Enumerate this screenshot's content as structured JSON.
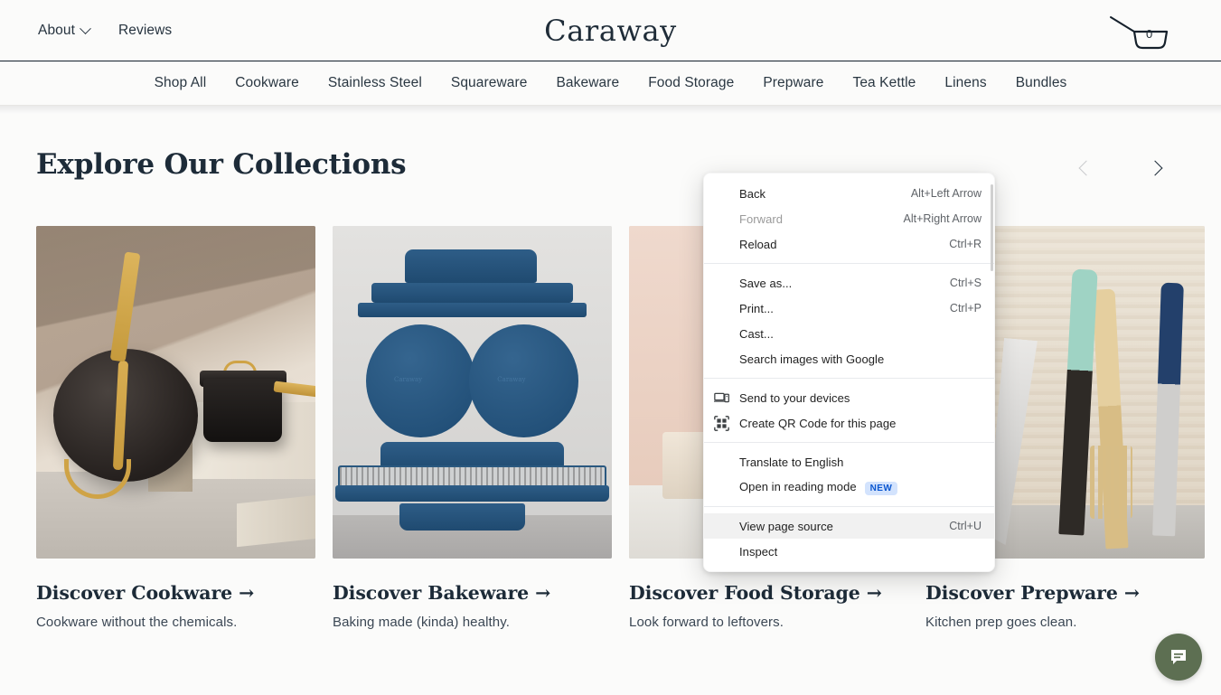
{
  "brand": {
    "name": "Caraway"
  },
  "topnav": {
    "left_items": [
      {
        "label": "About",
        "has_chevron": true
      },
      {
        "label": "Reviews",
        "has_chevron": false
      }
    ],
    "cart": {
      "icon": "shopping-basket-icon",
      "count": "0"
    }
  },
  "subnav": {
    "items": [
      "Shop All",
      "Cookware",
      "Stainless Steel",
      "Squareware",
      "Bakeware",
      "Food Storage",
      "Prepware",
      "Tea Kettle",
      "Linens",
      "Bundles"
    ]
  },
  "collections": {
    "heading": "Explore Our Collections",
    "carousel": {
      "prev_icon": "chevron-left-icon",
      "next_icon": "chevron-right-icon",
      "prev_enabled": false,
      "next_enabled": true
    },
    "cards": [
      {
        "title": "Discover Cookware →",
        "subtitle": "Cookware without the chemicals.",
        "image_alt": "black-frying-pan-and-saucepan-with-gold-handles"
      },
      {
        "title": "Discover Bakeware →",
        "subtitle": "Baking made (kinda) healthy.",
        "image_alt": "stacked-navy-blue-bakeware-set"
      },
      {
        "title": "Discover Food Storage →",
        "subtitle": "Look forward to leftovers.",
        "image_alt": "food-storage-containers-on-pink-backdrop"
      },
      {
        "title": "Discover Prepware →",
        "subtitle": "Kitchen prep goes clean.",
        "image_alt": "knives-and-pasta-server-standing-upright"
      }
    ]
  },
  "context_menu": {
    "groups": [
      {
        "items": [
          {
            "label": "Back",
            "accel": "Alt+Left Arrow",
            "icon": null,
            "disabled": false,
            "hovered": false,
            "badge": null
          },
          {
            "label": "Forward",
            "accel": "Alt+Right Arrow",
            "icon": null,
            "disabled": true,
            "hovered": false,
            "badge": null
          },
          {
            "label": "Reload",
            "accel": "Ctrl+R",
            "icon": null,
            "disabled": false,
            "hovered": false,
            "badge": null
          }
        ]
      },
      {
        "items": [
          {
            "label": "Save as...",
            "accel": "Ctrl+S",
            "icon": null,
            "disabled": false,
            "hovered": false,
            "badge": null
          },
          {
            "label": "Print...",
            "accel": "Ctrl+P",
            "icon": null,
            "disabled": false,
            "hovered": false,
            "badge": null
          },
          {
            "label": "Cast...",
            "accel": "",
            "icon": null,
            "disabled": false,
            "hovered": false,
            "badge": null
          },
          {
            "label": "Search images with Google",
            "accel": "",
            "icon": null,
            "disabled": false,
            "hovered": false,
            "badge": null
          }
        ]
      },
      {
        "items": [
          {
            "label": "Send to your devices",
            "accel": "",
            "icon": "devices-icon",
            "disabled": false,
            "hovered": false,
            "badge": null
          },
          {
            "label": "Create QR Code for this page",
            "accel": "",
            "icon": "qr-code-icon",
            "disabled": false,
            "hovered": false,
            "badge": null
          }
        ]
      },
      {
        "items": [
          {
            "label": "Translate to English",
            "accel": "",
            "icon": null,
            "disabled": false,
            "hovered": false,
            "badge": null
          },
          {
            "label": "Open in reading mode",
            "accel": "",
            "icon": null,
            "disabled": false,
            "hovered": false,
            "badge": "NEW"
          }
        ]
      },
      {
        "items": [
          {
            "label": "View page source",
            "accel": "Ctrl+U",
            "icon": null,
            "disabled": false,
            "hovered": true,
            "badge": null
          },
          {
            "label": "Inspect",
            "accel": "",
            "icon": null,
            "disabled": false,
            "hovered": false,
            "badge": null
          }
        ]
      }
    ]
  },
  "chat_widget": {
    "icon": "chat-bubble-icon",
    "color": "#5d6f52"
  },
  "colors": {
    "page_background": "#fbfbfa",
    "text_dark": "#1d2b38",
    "menu_highlight": "#f1f1f1",
    "badge_background": "#d3e3fd",
    "badge_text": "#0b57d0",
    "chat_green": "#5d6f52"
  }
}
